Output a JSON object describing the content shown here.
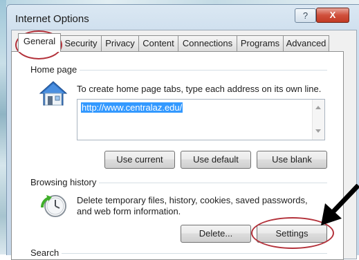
{
  "window": {
    "title": "Internet Options",
    "help_label": "?",
    "close_label": "X"
  },
  "tabs": [
    {
      "label": "General",
      "active": true
    },
    {
      "label": "Security",
      "active": false
    },
    {
      "label": "Privacy",
      "active": false
    },
    {
      "label": "Content",
      "active": false
    },
    {
      "label": "Connections",
      "active": false
    },
    {
      "label": "Programs",
      "active": false
    },
    {
      "label": "Advanced",
      "active": false
    }
  ],
  "home_page": {
    "heading": "Home page",
    "instruction": "To create home page tabs, type each address on its own line.",
    "url": "http://www.centralaz.edu/",
    "buttons": {
      "use_current": "Use current",
      "use_default": "Use default",
      "use_blank": "Use blank"
    }
  },
  "browsing_history": {
    "heading": "Browsing history",
    "description_line1": "Delete temporary files, history, cookies, saved passwords,",
    "description_line2": "and web form information.",
    "buttons": {
      "delete": "Delete...",
      "settings": "Settings"
    }
  },
  "search": {
    "heading": "Search"
  },
  "colors": {
    "annotation_red": "#b3313a",
    "selection_blue": "#3399ff",
    "arrow": "#000000"
  }
}
